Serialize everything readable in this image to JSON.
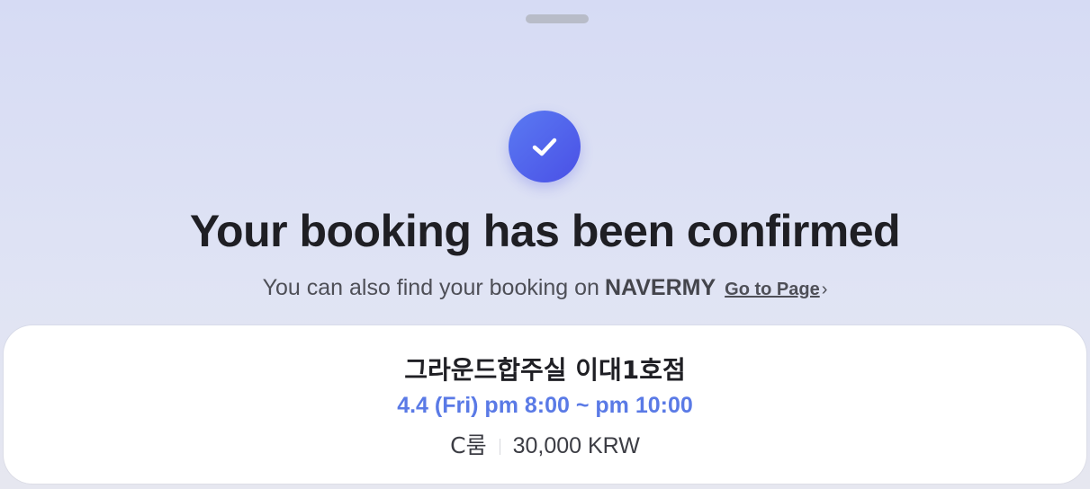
{
  "header": {
    "title": "Your booking has been confirmed",
    "subtitle_text": "You can also find your booking on",
    "brand": "NAVERMY",
    "link_label": "Go to Page",
    "link_chevron": "›"
  },
  "icons": {
    "check": "check-icon",
    "handle": "drag-handle"
  },
  "colors": {
    "accent": "#4a50e6",
    "time_text": "#5a7ae6"
  },
  "booking": {
    "place_name": "그라운드합주실 이대1호점",
    "time": "4.4 (Fri) pm 8:00 ~ pm 10:00",
    "room": "C룸",
    "price": "30,000 KRW"
  }
}
